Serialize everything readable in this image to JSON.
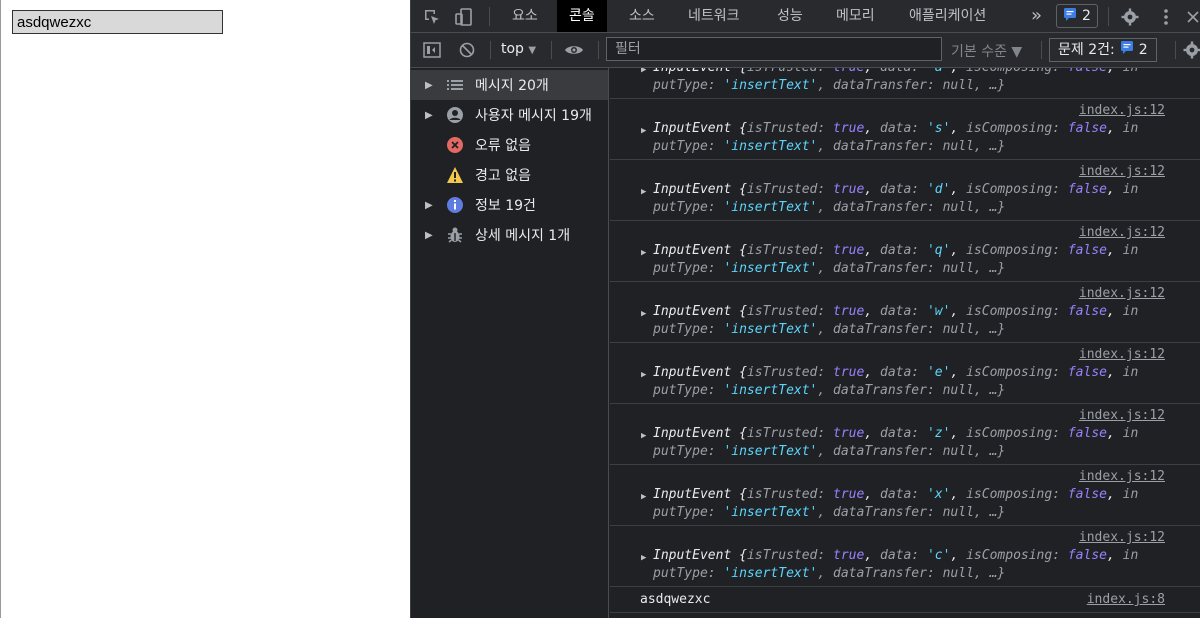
{
  "page": {
    "input_value": "asdqwezxc"
  },
  "devtools": {
    "tabs": [
      "요소",
      "콘솔",
      "소스",
      "네트워크",
      "성능",
      "메모리",
      "애플리케이션"
    ],
    "more_tabs": "»",
    "issue_badge_count": "2",
    "toolbar": {
      "context": "top",
      "context_arrow": "▼",
      "filter_placeholder": "필터",
      "levels": "기본 수준 ▼",
      "issues_label": "문제 2건:",
      "issues_count": "2"
    },
    "sidebar": [
      {
        "label": "메시지 20개",
        "icon": "list-icon",
        "expandable": true,
        "selected": true
      },
      {
        "label": "사용자 메시지 19개",
        "icon": "user-icon",
        "expandable": true,
        "selected": false
      },
      {
        "label": "오류 없음",
        "icon": "error-icon",
        "expandable": false,
        "selected": false
      },
      {
        "label": "경고 없음",
        "icon": "warning-icon",
        "expandable": false,
        "selected": false
      },
      {
        "label": "정보 19건",
        "icon": "info-icon",
        "expandable": true,
        "selected": false
      },
      {
        "label": "상세 메시지 1개",
        "icon": "bug-icon",
        "expandable": true,
        "selected": false
      }
    ],
    "console": {
      "source": "index.js:12",
      "event_name": "InputEvent",
      "first_data": "a",
      "entries": [
        "s",
        "d",
        "q",
        "w",
        "e",
        "z",
        "x",
        "c"
      ],
      "last_message": {
        "text": "asdqwezxc",
        "source": "index.js:8"
      }
    }
  }
}
